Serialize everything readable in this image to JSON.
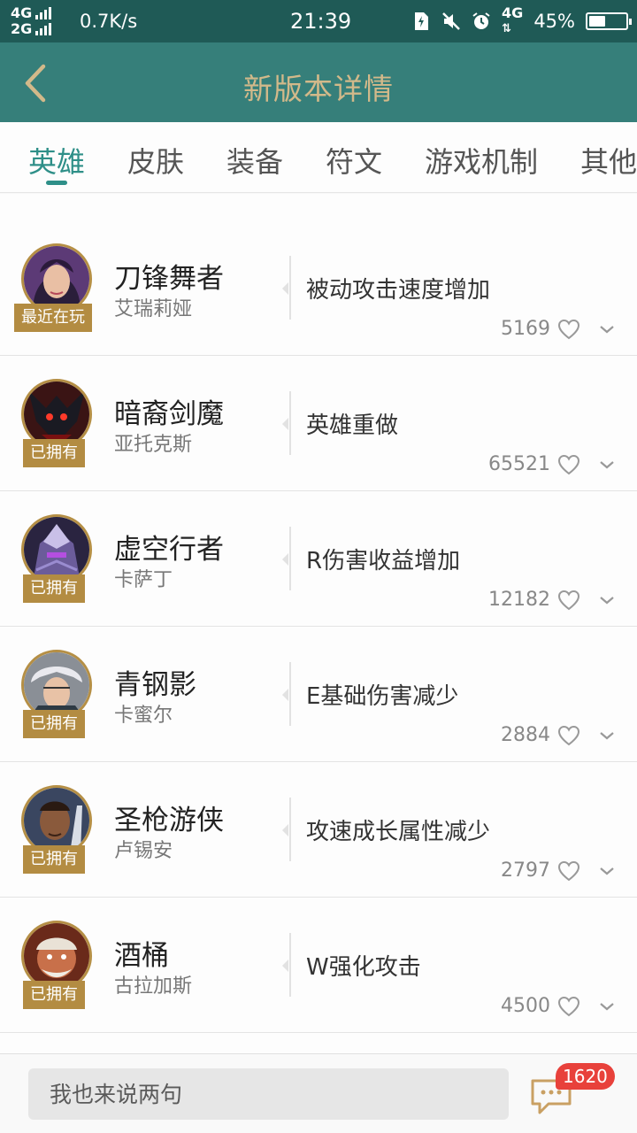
{
  "status_bar": {
    "net1": "4G",
    "net2": "2G",
    "speed": "0.7K/s",
    "time": "21:39",
    "net3": "4G",
    "battery": "45%",
    "battery_level": 0.45
  },
  "header": {
    "title": "新版本详情"
  },
  "tabs": [
    {
      "label": "英雄"
    },
    {
      "label": "皮肤"
    },
    {
      "label": "装备"
    },
    {
      "label": "符文"
    },
    {
      "label": "游戏机制"
    },
    {
      "label": "其他"
    }
  ],
  "heroes": [
    {
      "name": "刀锋舞者",
      "sub": "艾瑞莉娅",
      "badge": "最近在玩",
      "change": "被动攻击速度增加",
      "likes": "5169"
    },
    {
      "name": "暗裔剑魔",
      "sub": "亚托克斯",
      "badge": "已拥有",
      "change": "英雄重做",
      "likes": "65521"
    },
    {
      "name": "虚空行者",
      "sub": "卡萨丁",
      "badge": "已拥有",
      "change": "R伤害收益增加",
      "likes": "12182"
    },
    {
      "name": "青钢影",
      "sub": "卡蜜尔",
      "badge": "已拥有",
      "change": "E基础伤害减少",
      "likes": "2884"
    },
    {
      "name": "圣枪游侠",
      "sub": "卢锡安",
      "badge": "已拥有",
      "change": "攻速成长属性减少",
      "likes": "2797"
    },
    {
      "name": "酒桶",
      "sub": "古拉加斯",
      "badge": "已拥有",
      "change": "W强化攻击",
      "likes": "4500"
    }
  ],
  "icons": {
    "back": "back-chevron-icon",
    "like": "heart-outline-icon",
    "expand": "chevron-down-icon",
    "message": "chat-bubble-icon"
  },
  "bottom_bar": {
    "placeholder": "我也来说两句",
    "message_count": "1620"
  },
  "colors": {
    "status_bar": "#1f5a56",
    "header": "#367f7a",
    "title_gold": "#d2b98a",
    "tab_active": "#2e8f88",
    "badge": "#b38c42",
    "count_badge": "#e8413b"
  }
}
